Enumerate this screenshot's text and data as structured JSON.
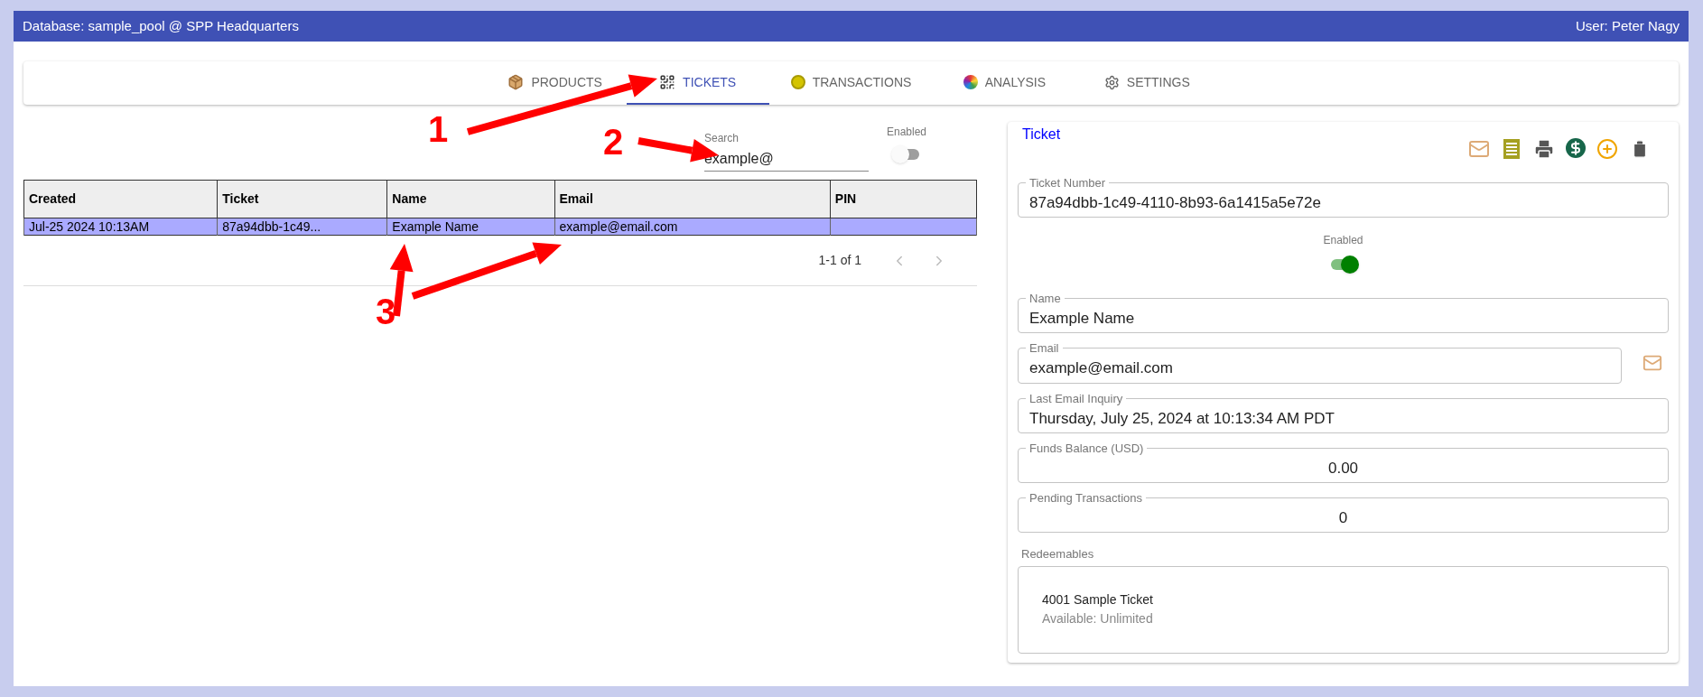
{
  "header": {
    "database": "Database: sample_pool @ SPP Headquarters",
    "user": "User: Peter Nagy"
  },
  "tabs": [
    {
      "label": "PRODUCTS",
      "selected": false
    },
    {
      "label": "TICKETS",
      "selected": true
    },
    {
      "label": "TRANSACTIONS",
      "selected": false
    },
    {
      "label": "ANALYSIS",
      "selected": false
    },
    {
      "label": "SETTINGS",
      "selected": false
    }
  ],
  "search": {
    "label": "Search",
    "value": "example@"
  },
  "filter_toggle": {
    "label": "Enabled",
    "on": false
  },
  "table": {
    "columns": [
      "Created",
      "Ticket",
      "Name",
      "Email",
      "PIN"
    ],
    "rows": [
      {
        "cells": [
          "Jul-25 2024 10:13AM",
          "87a94dbb-1c49...",
          "Example Name",
          "example@email.com"
        ],
        "selected": true
      }
    ],
    "pagination": "1-1 of 1"
  },
  "ticket": {
    "title": "Ticket",
    "fields_top": [
      {
        "label": "Ticket Number",
        "value": "87a94dbb-1c49-4110-8b93-6a1415a5e72e"
      }
    ],
    "enabled": {
      "label": "Enabled",
      "on": true
    },
    "fields": [
      {
        "kind": "text",
        "label": "Name",
        "value": "Example Name"
      },
      {
        "kind": "email",
        "label": "Email",
        "value": "example@email.com"
      },
      {
        "kind": "text",
        "label": "Last Email Inquiry",
        "value": "Thursday, July 25, 2024 at 10:13:34 AM PDT"
      },
      {
        "kind": "amount",
        "label": "Funds Balance (USD)",
        "value": "0.00"
      },
      {
        "kind": "amount",
        "label": "Pending Transactions",
        "value": "0"
      }
    ],
    "redeemables": {
      "label": "Redeemables",
      "items": [
        {
          "name": "4001 Sample Ticket",
          "availability": "Available: Unlimited"
        }
      ]
    }
  },
  "annotations": [
    {
      "label": "1"
    },
    {
      "label": "2"
    },
    {
      "label": "3"
    }
  ]
}
